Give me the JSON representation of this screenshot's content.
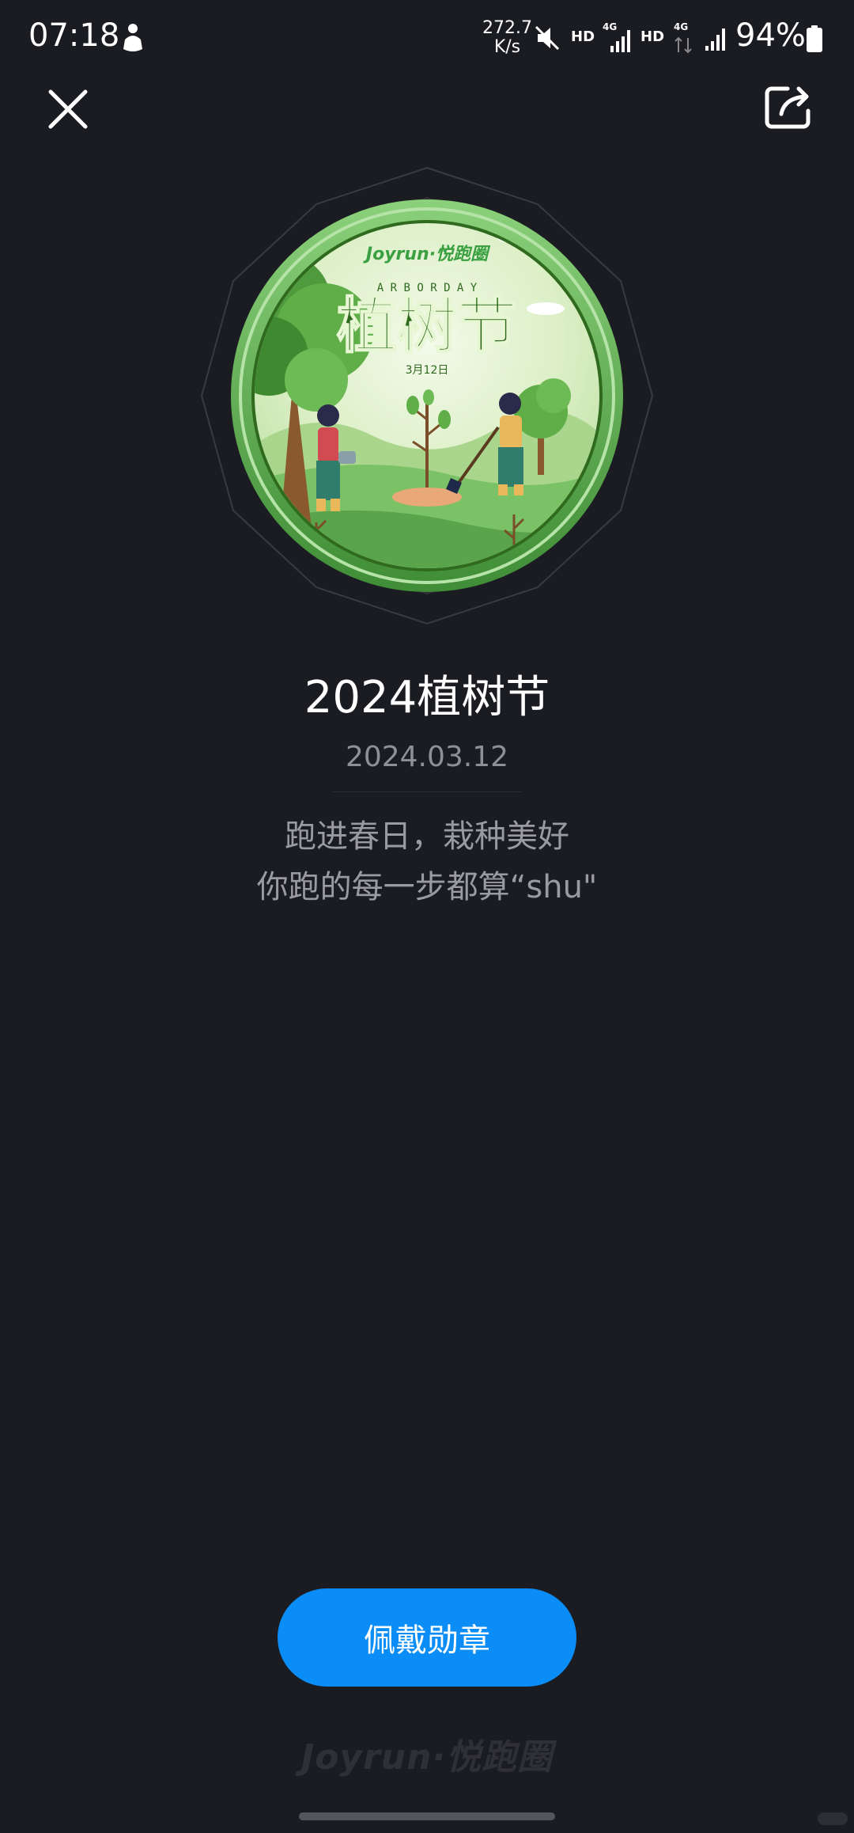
{
  "status_bar": {
    "time": "07:18",
    "net_speed_value": "272.7",
    "net_speed_unit": "K/s",
    "hd_1": "HD",
    "network_1": "4G",
    "hd_2": "HD",
    "network_2": "4G",
    "battery": "94%"
  },
  "nav": {
    "close_icon": "close-icon",
    "share_icon": "share-icon"
  },
  "badge": {
    "brand": "Joyrun·悦跑圈",
    "subtitle_en": "A R B O R   D A Y",
    "headline": "植树节",
    "date_line": "3月12日",
    "colors": {
      "ring": "#5aa54c",
      "inner": "#dcefc6",
      "grass": "#6cb65a",
      "title": "#2f6a1e",
      "brand": "#3aa042"
    }
  },
  "medal": {
    "title": "2024植树节",
    "date": "2024.03.12",
    "desc_line1": "跑进春日，栽种美好",
    "desc_line2": "你跑的每一步都算“shu\""
  },
  "actions": {
    "wear_button": "佩戴勋章"
  },
  "footer": {
    "logo": "Joyrun·悦跑圈"
  },
  "colors": {
    "background": "#1b1c21",
    "button": "#0a8df7",
    "muted_text": "#9a9ba1"
  }
}
